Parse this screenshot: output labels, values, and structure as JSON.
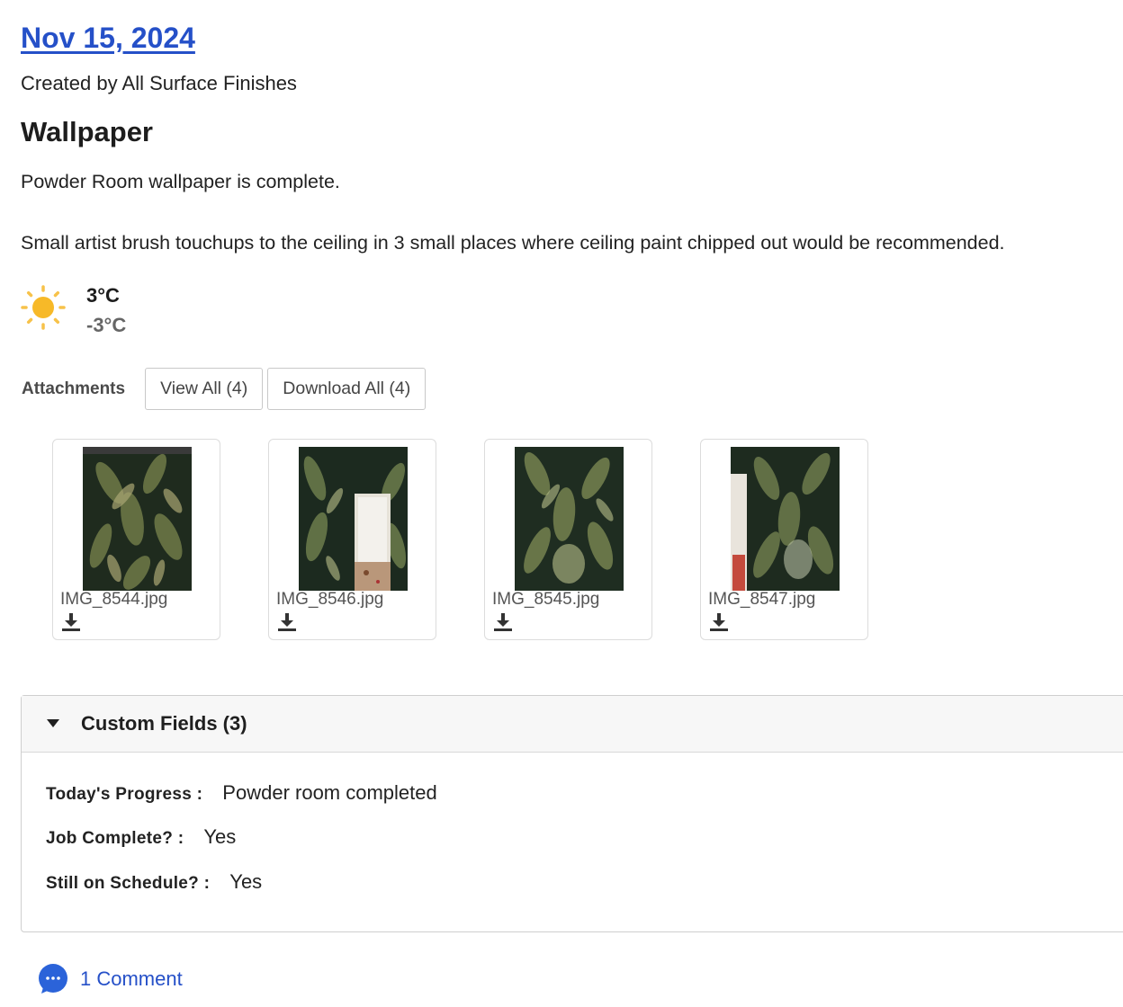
{
  "entry": {
    "date": "Nov 15, 2024",
    "created_by": "Created by All Surface Finishes",
    "title": "Wallpaper",
    "notes": [
      "Powder Room wallpaper is complete.",
      "Small artist brush touchups to the ceiling in 3 small places where ceiling paint chipped out would be recommended."
    ]
  },
  "weather": {
    "icon": "sun-icon",
    "high": "3°C",
    "low": "-3°C"
  },
  "attachments": {
    "label": "Attachments",
    "view_all": "View All (4)",
    "download_all": "Download All (4)",
    "files": [
      {
        "name": "IMG_8544.jpg"
      },
      {
        "name": "IMG_8546.jpg"
      },
      {
        "name": "IMG_8545.jpg"
      },
      {
        "name": "IMG_8547.jpg"
      }
    ]
  },
  "custom_fields": {
    "title": "Custom Fields (3)",
    "fields": [
      {
        "label": "Today's Progress :",
        "value": "Powder room completed"
      },
      {
        "label": "Job Complete? :",
        "value": "Yes"
      },
      {
        "label": "Still on Schedule? :",
        "value": "Yes"
      }
    ]
  },
  "comments": {
    "label": "1 Comment"
  },
  "colors": {
    "link": "#2550c8",
    "sun": "#f7b928"
  }
}
